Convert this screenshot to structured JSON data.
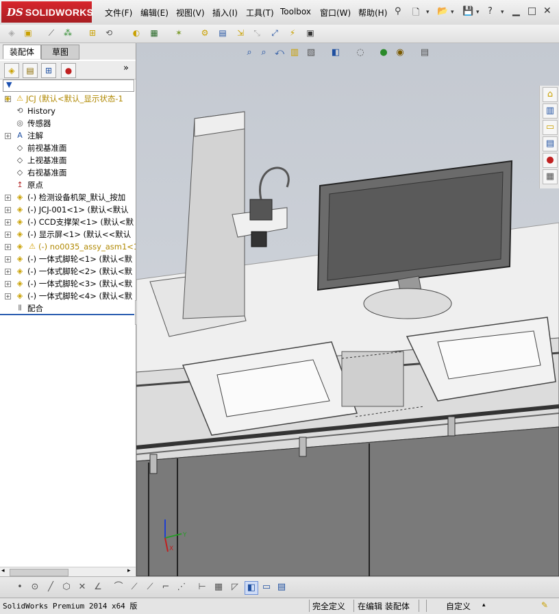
{
  "app": {
    "logo_prefix": "DS",
    "logo_text": "SOLIDWORKS"
  },
  "menu": [
    "文件(F)",
    "编辑(E)",
    "视图(V)",
    "插入(I)",
    "工具(T)",
    "Toolbox",
    "窗口(W)",
    "帮助(H)"
  ],
  "panel": {
    "tabs": [
      "装配体",
      "草图"
    ],
    "tree": [
      {
        "label": "JCJ  (默认<默认_显示状态-1",
        "icon": "assembly-icon",
        "warn": true,
        "expand": true,
        "indent": 0
      },
      {
        "label": "History",
        "icon": "history-icon",
        "indent": 1
      },
      {
        "label": "传感器",
        "icon": "sensor-icon",
        "indent": 1
      },
      {
        "label": "注解",
        "icon": "annotation-icon",
        "expand": true,
        "indent": 1
      },
      {
        "label": "前视基准面",
        "icon": "plane-icon",
        "indent": 1
      },
      {
        "label": "上视基准面",
        "icon": "plane-icon",
        "indent": 1
      },
      {
        "label": "右视基准面",
        "icon": "plane-icon",
        "indent": 1
      },
      {
        "label": "原点",
        "icon": "origin-icon",
        "indent": 1
      },
      {
        "label": "(-) 检测设备机架_默认_按加",
        "icon": "part-icon",
        "expand": true,
        "indent": 1
      },
      {
        "label": "(-) JCJ-001<1> (默认<默认",
        "icon": "part-icon",
        "expand": true,
        "indent": 1
      },
      {
        "label": "(-) CCD支撑架<1> (默认<默",
        "icon": "part-icon",
        "expand": true,
        "indent": 1
      },
      {
        "label": "(-) 显示屏<1> (默认<<默认",
        "icon": "part-icon",
        "expand": true,
        "indent": 1
      },
      {
        "label": "(-) no0035_assy_asm1<1>",
        "icon": "part-icon",
        "warn": true,
        "expand": true,
        "indent": 1
      },
      {
        "label": "(-) 一体式脚轮<1> (默认<默",
        "icon": "part-icon",
        "expand": true,
        "indent": 1
      },
      {
        "label": "(-) 一体式脚轮<2> (默认<默",
        "icon": "part-icon",
        "expand": true,
        "indent": 1
      },
      {
        "label": "(-) 一体式脚轮<3> (默认<默",
        "icon": "part-icon",
        "expand": true,
        "indent": 1
      },
      {
        "label": "(-) 一体式脚轮<4> (默认<默",
        "icon": "part-icon",
        "expand": true,
        "indent": 1
      },
      {
        "label": "配合",
        "icon": "mates-icon",
        "indent": 1
      }
    ]
  },
  "triad": {
    "x": "X",
    "y": "Y"
  },
  "status": {
    "product": "SolidWorks Premium 2014 x64 版",
    "defined": "完全定义",
    "editing": "在编辑 装配体",
    "units": "自定义"
  }
}
